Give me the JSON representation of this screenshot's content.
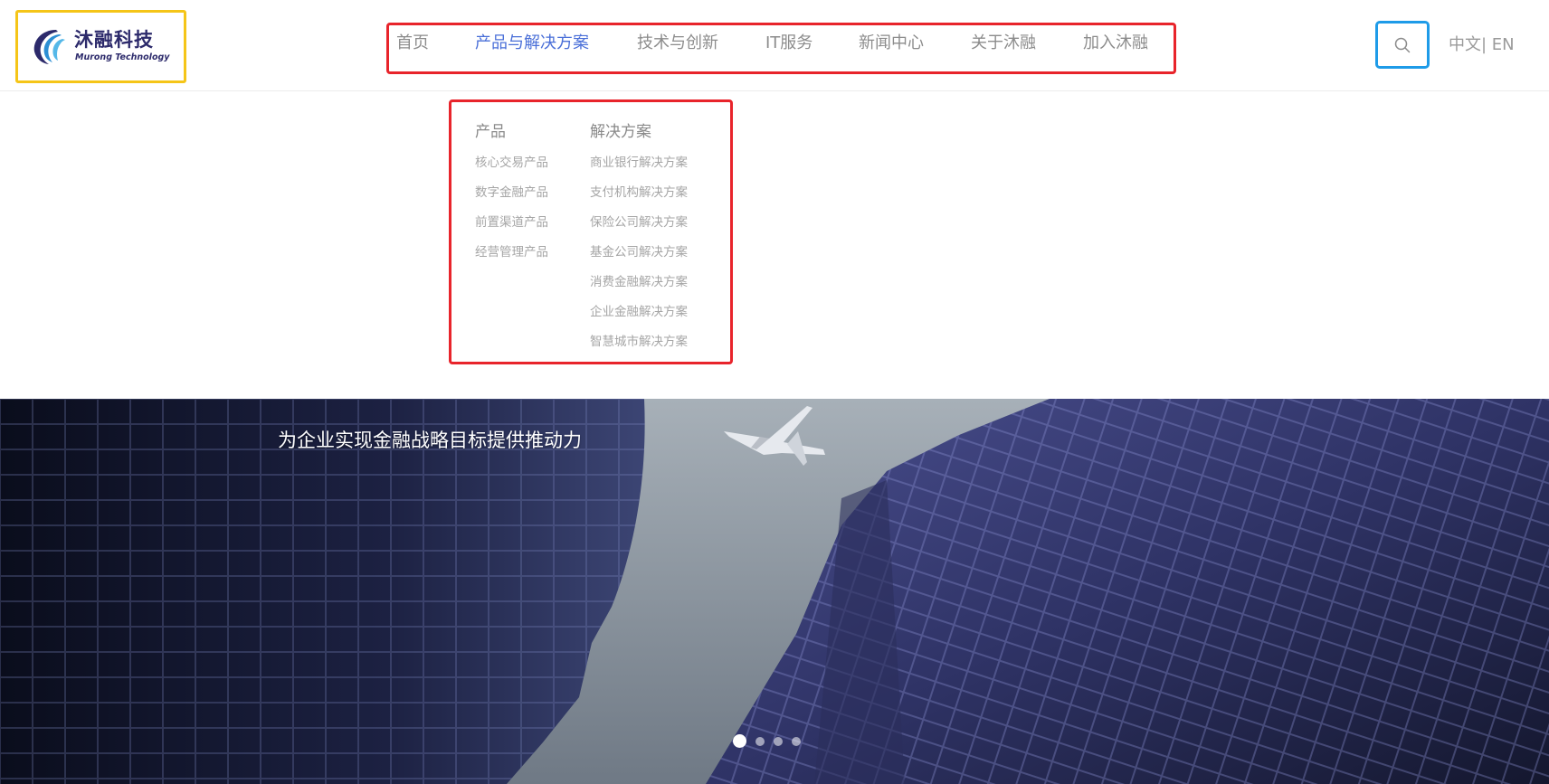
{
  "brand": {
    "name": "沐融科技",
    "tagline": "Murong Technology",
    "color": "#2c2a6b"
  },
  "nav": {
    "items": [
      {
        "label": "首页",
        "active": false
      },
      {
        "label": "产品与解决方案",
        "active": true
      },
      {
        "label": "技术与创新",
        "active": false
      },
      {
        "label": "IT服务",
        "active": false
      },
      {
        "label": "新闻中心",
        "active": false
      },
      {
        "label": "关于沐融",
        "active": false
      },
      {
        "label": "加入沐融",
        "active": false
      }
    ],
    "active_color": "#4a6fd8",
    "inactive_color": "#8c8c8c"
  },
  "search": {
    "icon": "search-icon"
  },
  "language": {
    "zh": "中文|",
    "en": " EN"
  },
  "dropdown": {
    "products": {
      "heading": "产品",
      "items": [
        "核心交易产品",
        "数字金融产品",
        "前置渠道产品",
        "经营管理产品"
      ]
    },
    "solutions": {
      "heading": "解决方案",
      "items": [
        "商业银行解决方案",
        "支付机构解决方案",
        "保险公司解决方案",
        "基金公司解决方案",
        "消费金融解决方案",
        "企业金融解决方案",
        "智慧城市解决方案"
      ]
    }
  },
  "hero": {
    "caption": "为企业实现金融战略目标提供推动力",
    "slide_count": 4,
    "active_slide": 1
  },
  "annotation_colors": {
    "logo_box": "#f5c518",
    "nav_box": "#e8242b",
    "dropdown_box": "#e8242b",
    "search_box": "#1e9be8"
  }
}
